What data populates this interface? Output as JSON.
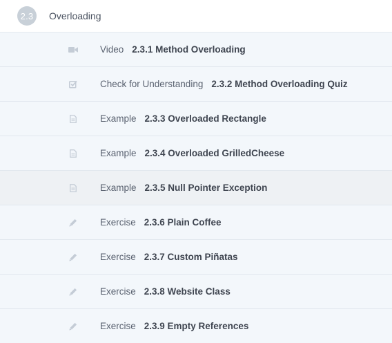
{
  "module": {
    "number": "2.3",
    "title": "Overloading"
  },
  "items": [
    {
      "type": "Video",
      "title": "2.3.1 Method Overloading",
      "icon": "video-camera-icon"
    },
    {
      "type": "Check for Understanding",
      "title": "2.3.2 Method Overloading Quiz",
      "icon": "checkbox-icon"
    },
    {
      "type": "Example",
      "title": "2.3.3 Overloaded Rectangle",
      "icon": "document-icon"
    },
    {
      "type": "Example",
      "title": "2.3.4 Overloaded GrilledCheese",
      "icon": "document-icon"
    },
    {
      "type": "Example",
      "title": "2.3.5 Null Pointer Exception",
      "icon": "document-icon"
    },
    {
      "type": "Exercise",
      "title": "2.3.6 Plain Coffee",
      "icon": "pencil-icon"
    },
    {
      "type": "Exercise",
      "title": "2.3.7 Custom Piñatas",
      "icon": "pencil-icon"
    },
    {
      "type": "Exercise",
      "title": "2.3.8 Website Class",
      "icon": "pencil-icon"
    },
    {
      "type": "Exercise",
      "title": "2.3.9 Empty References",
      "icon": "pencil-icon"
    }
  ],
  "colors": {
    "icon": "#c4ccd6",
    "row_background": "#f3f7fb",
    "row_hover_background": "#eef1f4",
    "badge": "#c8d0d8"
  }
}
